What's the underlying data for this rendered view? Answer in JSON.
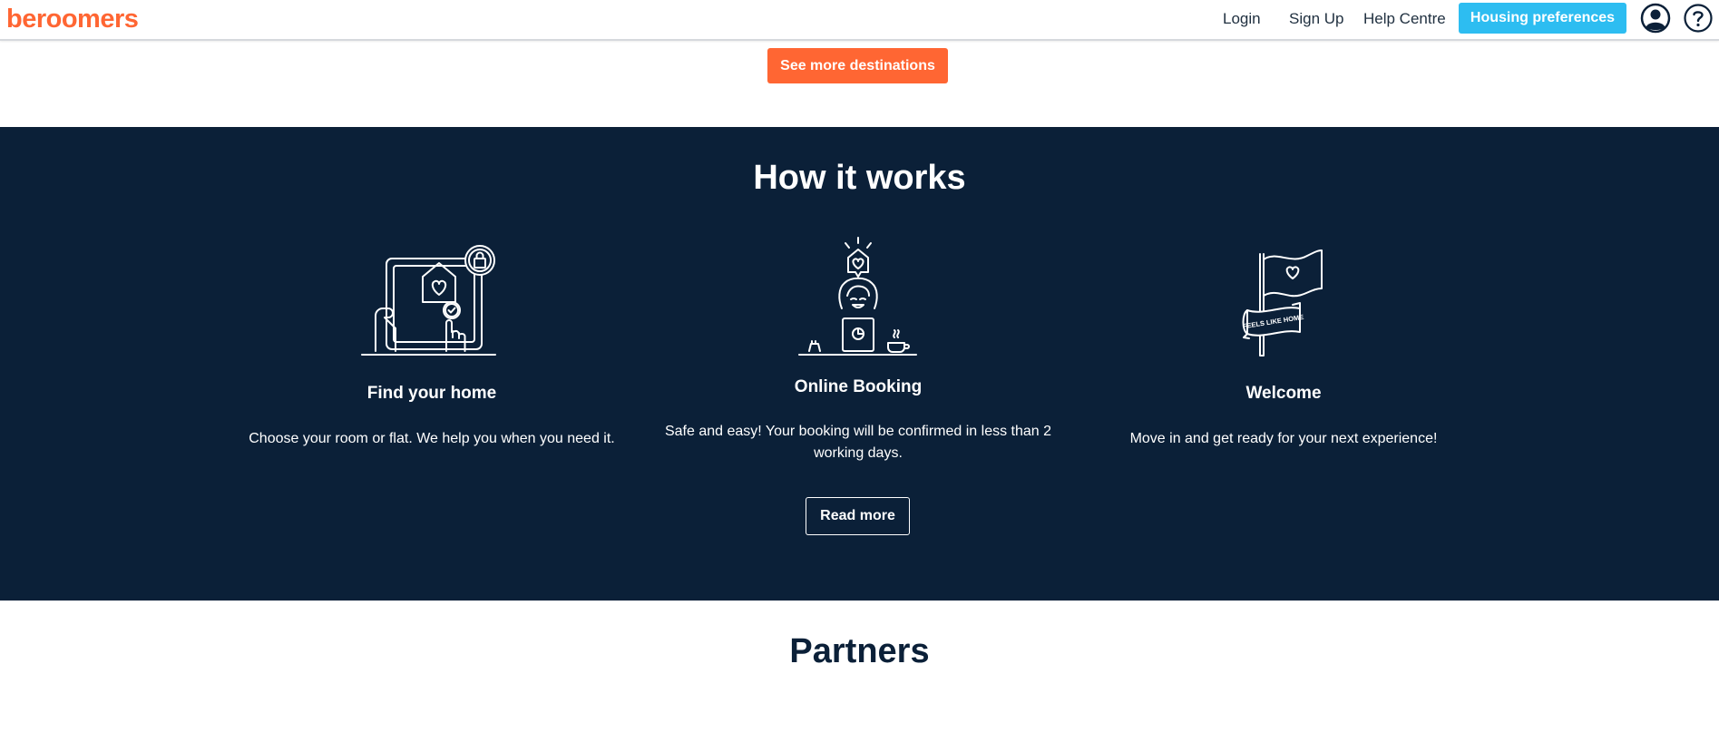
{
  "header": {
    "logo": "beroomers",
    "nav": {
      "login": "Login",
      "signup": "Sign Up",
      "help": "Help Centre"
    },
    "preferences_button": "Housing preferences"
  },
  "destinations": {
    "see_more": "See more destinations"
  },
  "how_it_works": {
    "title": "How it works",
    "steps": [
      {
        "title": "Find your home",
        "description": "Choose your room or flat. We help you when you need it."
      },
      {
        "title": "Online Booking",
        "description": "Safe and easy! Your booking will be confirmed in less than 2 working days."
      },
      {
        "title": "Welcome",
        "description": "Move in and get ready for your next experience!"
      }
    ],
    "flag_text": "FEELS LIKE HOME",
    "read_more": "Read more"
  },
  "partners": {
    "title": "Partners"
  },
  "colors": {
    "brand_orange": "#ff6633",
    "accent_blue": "#2dbdf1",
    "navy": "#0b2038"
  }
}
